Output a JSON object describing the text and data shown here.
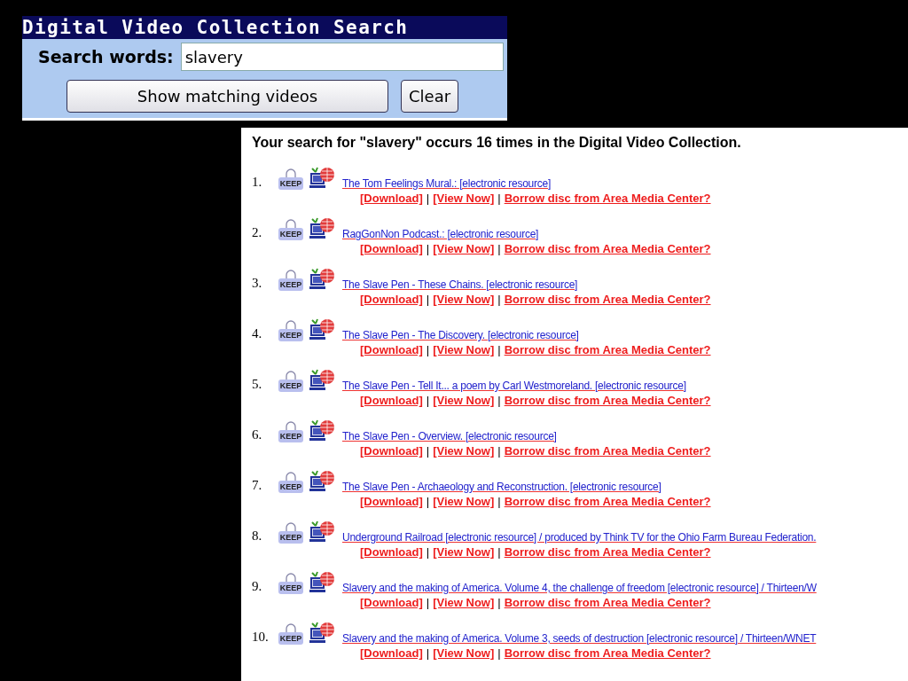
{
  "header": {
    "title": "Digital Video Collection Search"
  },
  "search": {
    "label": "Search words:",
    "value": "slavery"
  },
  "buttons": [
    "Show matching videos",
    "Clear"
  ],
  "summary": "Your search for \"slavery\" occurs 16 times in the Digital Video Collection.",
  "results": [
    {
      "number": "1.",
      "keep": "KEEP",
      "title": "The Tom Feelings Mural.: [electronic resource]",
      "links": [
        {
          "kind": "link",
          "text": "[Download]"
        },
        {
          "kind": "separator",
          "text": "|"
        },
        {
          "kind": "link",
          "text": "[View Now]"
        },
        {
          "kind": "separator",
          "text": "|"
        },
        {
          "kind": "link",
          "text": "Borrow disc from Area Media Center?"
        }
      ]
    },
    {
      "number": "2.",
      "keep": "KEEP",
      "title": "RagGonNon Podcast.: [electronic resource]",
      "links": [
        {
          "kind": "link",
          "text": "[Download]"
        },
        {
          "kind": "separator",
          "text": "|"
        },
        {
          "kind": "link",
          "text": "[View Now]"
        },
        {
          "kind": "separator",
          "text": "|"
        },
        {
          "kind": "link",
          "text": "Borrow disc from Area Media Center?"
        }
      ]
    },
    {
      "number": "3.",
      "keep": "KEEP",
      "title": "The Slave Pen - These Chains. [electronic resource]",
      "links": [
        {
          "kind": "link",
          "text": "[Download]"
        },
        {
          "kind": "separator",
          "text": "|"
        },
        {
          "kind": "link",
          "text": "[View Now]"
        },
        {
          "kind": "separator",
          "text": "|"
        },
        {
          "kind": "link",
          "text": "Borrow disc from Area Media Center?"
        }
      ]
    },
    {
      "number": "4.",
      "keep": "KEEP",
      "title": "The Slave Pen - The Discovery. [electronic resource]",
      "links": [
        {
          "kind": "link",
          "text": "[Download]"
        },
        {
          "kind": "separator",
          "text": "|"
        },
        {
          "kind": "link",
          "text": "[View Now]"
        },
        {
          "kind": "separator",
          "text": "|"
        },
        {
          "kind": "link",
          "text": "Borrow disc from Area Media Center?"
        }
      ]
    },
    {
      "number": "5.",
      "keep": "KEEP",
      "title": "The Slave Pen - Tell It... a poem by Carl Westmoreland. [electronic resource]",
      "links": [
        {
          "kind": "link",
          "text": "[Download]"
        },
        {
          "kind": "separator",
          "text": "|"
        },
        {
          "kind": "link",
          "text": "[View Now]"
        },
        {
          "kind": "separator",
          "text": "|"
        },
        {
          "kind": "link",
          "text": "Borrow disc from Area Media Center?"
        }
      ]
    },
    {
      "number": "6.",
      "keep": "KEEP",
      "title": "The Slave Pen - Overview. [electronic resource]",
      "links": [
        {
          "kind": "link",
          "text": "[Download]"
        },
        {
          "kind": "separator",
          "text": "|"
        },
        {
          "kind": "link",
          "text": "[View Now]"
        },
        {
          "kind": "separator",
          "text": "|"
        },
        {
          "kind": "link",
          "text": "Borrow disc from Area Media Center?"
        }
      ]
    },
    {
      "number": "7.",
      "keep": "KEEP",
      "title": "The Slave Pen - Archaeology and Reconstruction. [electronic resource]",
      "links": [
        {
          "kind": "link",
          "text": "[Download]"
        },
        {
          "kind": "separator",
          "text": "|"
        },
        {
          "kind": "link",
          "text": "[View Now]"
        },
        {
          "kind": "separator",
          "text": "|"
        },
        {
          "kind": "link",
          "text": "Borrow disc from Area Media Center?"
        }
      ]
    },
    {
      "number": "8.",
      "keep": "KEEP",
      "title": "Underground Railroad [electronic resource] / produced by Think TV for the Ohio Farm Bureau Federation.",
      "links": [
        {
          "kind": "link",
          "text": "[Download]"
        },
        {
          "kind": "separator",
          "text": "|"
        },
        {
          "kind": "link",
          "text": "[View Now]"
        },
        {
          "kind": "separator",
          "text": "|"
        },
        {
          "kind": "link",
          "text": "Borrow disc from Area Media Center?"
        }
      ]
    },
    {
      "number": "9.",
      "keep": "KEEP",
      "title": "Slavery and the making of America. Volume 4, the challenge of freedom [electronic resource] / Thirteen/W",
      "links": [
        {
          "kind": "link",
          "text": "[Download]"
        },
        {
          "kind": "separator",
          "text": "|"
        },
        {
          "kind": "link",
          "text": "[View Now]"
        },
        {
          "kind": "separator",
          "text": "|"
        },
        {
          "kind": "link",
          "text": "Borrow disc from Area Media Center?"
        }
      ]
    },
    {
      "number": "10.",
      "keep": "KEEP",
      "title": "Slavery and the making of America. Volume 3, seeds of destruction [electronic resource] / Thirteen/WNET",
      "links": [
        {
          "kind": "link",
          "text": "[Download]"
        },
        {
          "kind": "separator",
          "text": "|"
        },
        {
          "kind": "link",
          "text": "[View Now]"
        },
        {
          "kind": "separator",
          "text": "|"
        },
        {
          "kind": "link",
          "text": "Borrow disc from Area Media Center?"
        }
      ]
    }
  ]
}
